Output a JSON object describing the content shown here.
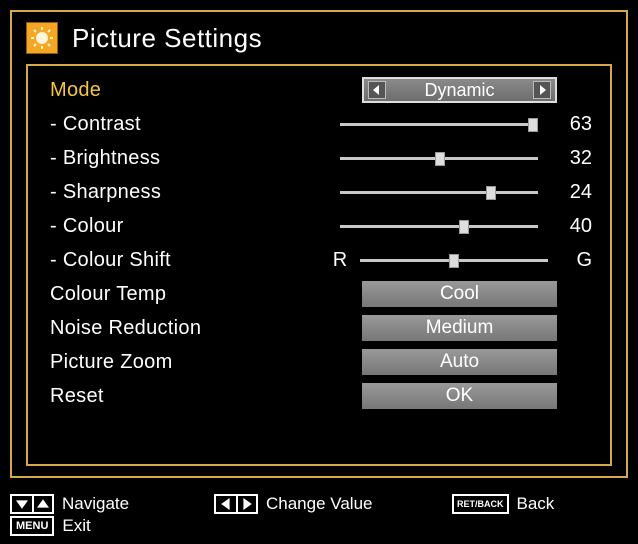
{
  "title": "Picture Settings",
  "mode": {
    "label": "Mode",
    "value": "Dynamic"
  },
  "sliders": {
    "contrast": {
      "label": "- Contrast",
      "value": 63,
      "min": 0,
      "max": 63
    },
    "brightness": {
      "label": "- Brightness",
      "value": 32,
      "min": 0,
      "max": 63
    },
    "sharpness": {
      "label": "- Sharpness",
      "value": 24,
      "min": 0,
      "max": 31
    },
    "colour": {
      "label": "- Colour",
      "value": 40,
      "min": 0,
      "max": 63
    },
    "colourShift": {
      "label": "- Colour Shift",
      "leftChar": "R",
      "rightChar": "G",
      "value": 0,
      "min": -10,
      "max": 10
    }
  },
  "buttons": {
    "colourTemp": {
      "label": "Colour Temp",
      "value": "Cool"
    },
    "noiseReduction": {
      "label": "Noise Reduction",
      "value": "Medium"
    },
    "pictureZoom": {
      "label": "Picture Zoom",
      "value": "Auto"
    },
    "reset": {
      "label": "Reset",
      "value": "OK"
    }
  },
  "footer": {
    "navigate": "Navigate",
    "changeValue": "Change Value",
    "back": "Back",
    "backKey": "RET/BACK",
    "exit": "Exit",
    "menuKey": "MENU"
  }
}
